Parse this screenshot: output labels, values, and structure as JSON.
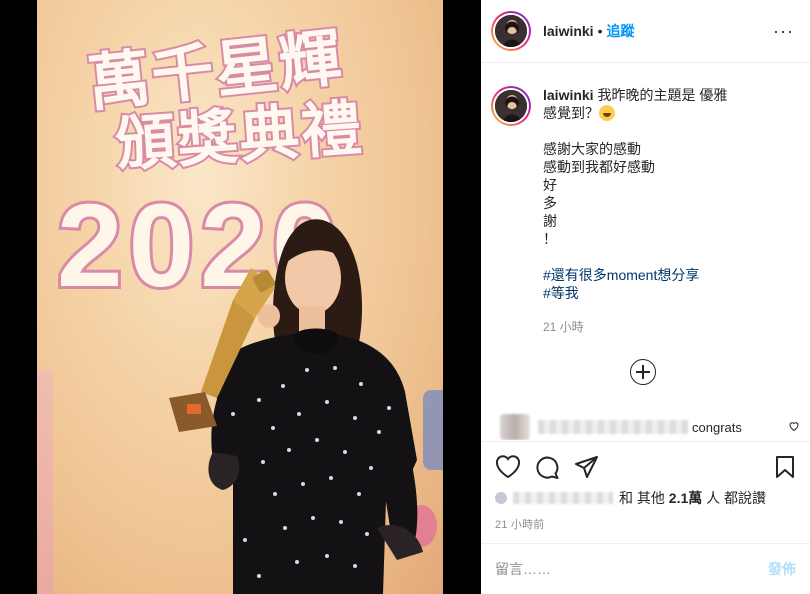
{
  "post": {
    "username": "laiwinki",
    "follow_label": "追蹤",
    "dot": "•",
    "more": "···"
  },
  "media": {
    "logo_line1": "萬千星輝",
    "logo_line2": "頒獎典禮",
    "logo_year": "2020"
  },
  "caption": {
    "username": "laiwinki",
    "line1": "我昨晚的主題是 優雅",
    "line2": "感覺到？",
    "lines": [
      "感謝大家的感動",
      "感動到我都好感動",
      "好",
      "多",
      "謝",
      "！"
    ],
    "hashtags": [
      "#還有很多moment想分享",
      "#等我"
    ],
    "time": "21 小時"
  },
  "comment": {
    "text": "congrats"
  },
  "likes": {
    "others_prefix": "和 其他",
    "count": "2.1萬",
    "suffix": "人 都說讚"
  },
  "time_ago": "21 小時前",
  "add_comment": {
    "placeholder": "留言……",
    "post_label": "發佈"
  },
  "colors": {
    "accent": "#0095f6",
    "hashtag": "#00376b",
    "muted": "#8e8e8e",
    "post_disabled": "#b2dffc"
  },
  "icons": [
    "more-options-icon",
    "add-comment-icon",
    "heart-icon",
    "comment-icon",
    "share-icon",
    "save-icon"
  ]
}
